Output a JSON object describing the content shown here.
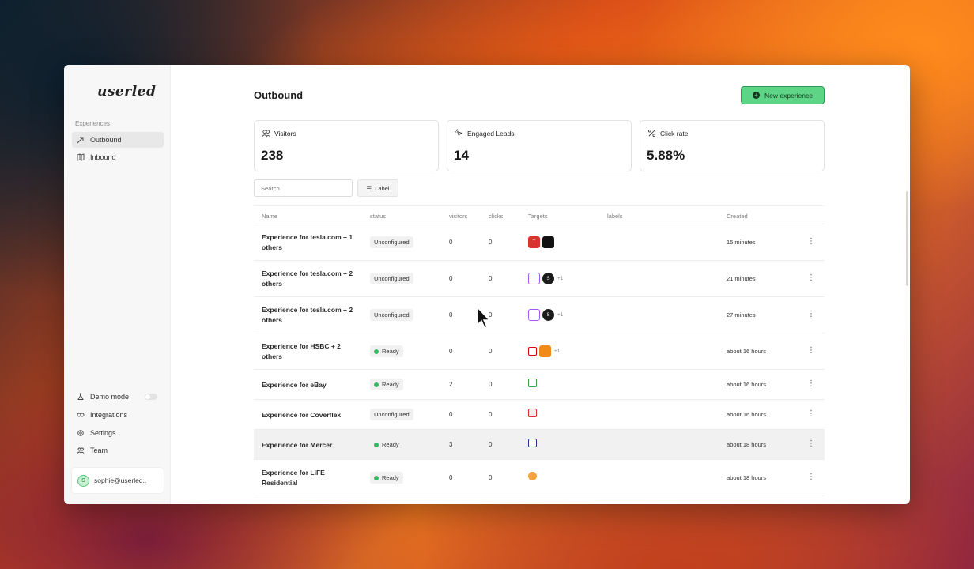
{
  "sidebar": {
    "logo": "userled",
    "section_label": "Experiences",
    "items": [
      {
        "label": "Outbound",
        "icon": "outbound-icon"
      },
      {
        "label": "Inbound",
        "icon": "map-icon"
      }
    ],
    "bottom_items": [
      {
        "label": "Demo mode",
        "icon": "flask-icon"
      },
      {
        "label": "Integrations",
        "icon": "link-icon"
      },
      {
        "label": "Settings",
        "icon": "gear-icon"
      },
      {
        "label": "Team",
        "icon": "team-icon"
      }
    ],
    "user": {
      "initial": "S",
      "email": "sophie@userled.."
    }
  },
  "header": {
    "title": "Outbound",
    "new_button_label": "New experience"
  },
  "stats": [
    {
      "label": "Visitors",
      "value": "238",
      "icon": "visitors-icon"
    },
    {
      "label": "Engaged Leads",
      "value": "14",
      "icon": "cursor-click-icon"
    },
    {
      "label": "Click rate",
      "value": "5.88%",
      "icon": "percent-icon"
    }
  ],
  "filters": {
    "search_placeholder": "Search",
    "label_button": "Label"
  },
  "table": {
    "columns": [
      "Name",
      "status",
      "visitors",
      "clicks",
      "Targets",
      "labels",
      "Created"
    ],
    "rows": [
      {
        "name": "Experience for tesla.com + 1 others",
        "status": "Unconfigured",
        "visitors": "0",
        "clicks": "0",
        "more": "",
        "created": "15 minutes"
      },
      {
        "name": "Experience for tesla.com + 2 others",
        "status": "Unconfigured",
        "visitors": "0",
        "clicks": "0",
        "more": "+1",
        "created": "21 minutes"
      },
      {
        "name": "Experience for tesla.com + 2 others",
        "status": "Unconfigured",
        "visitors": "0",
        "clicks": "0",
        "more": "+1",
        "created": "27 minutes"
      },
      {
        "name": "Experience for HSBC + 2 others",
        "status": "Ready",
        "visitors": "0",
        "clicks": "0",
        "more": "+1",
        "created": "about 16 hours"
      },
      {
        "name": "Experience for eBay",
        "status": "Ready",
        "visitors": "2",
        "clicks": "0",
        "more": "",
        "created": "about 16 hours"
      },
      {
        "name": "Experience for Coverflex",
        "status": "Unconfigured",
        "visitors": "0",
        "clicks": "0",
        "more": "",
        "created": "about 16 hours"
      },
      {
        "name": "Experience for Mercer",
        "status": "Ready",
        "visitors": "3",
        "clicks": "0",
        "more": "",
        "created": "about 18 hours"
      },
      {
        "name": "Experience for LiFE Residential",
        "status": "Ready",
        "visitors": "0",
        "clicks": "0",
        "more": "",
        "created": "about 18 hours"
      }
    ],
    "row_menu_glyph": "⋮"
  },
  "colors": {
    "accent_green": "#5ed486",
    "ready_dot": "#34b864"
  }
}
